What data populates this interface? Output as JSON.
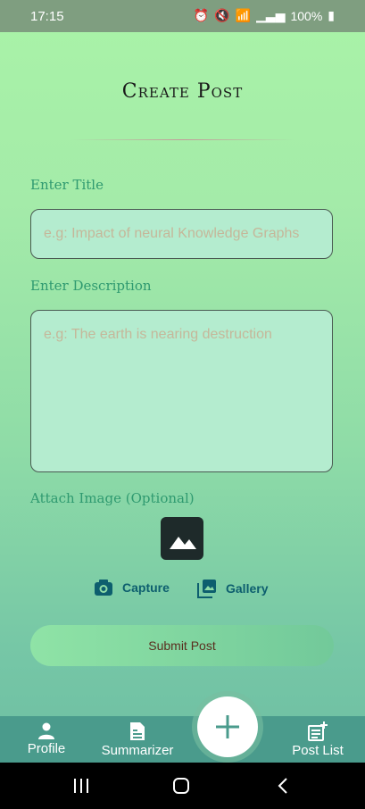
{
  "status": {
    "time": "17:15",
    "battery": "100%"
  },
  "page": {
    "title": "Create Post"
  },
  "form": {
    "title_label": "Enter Title",
    "title_placeholder": "e.g: Impact of neural Knowledge Graphs",
    "description_label": "Enter Description",
    "description_placeholder": "e.g: The earth is nearing destruction",
    "image_label": "Attach Image (Optional)",
    "capture_label": "Capture",
    "gallery_label": "Gallery",
    "submit_label": "Submit Post"
  },
  "nav": {
    "items": [
      {
        "label": "Profile",
        "icon": "person-icon"
      },
      {
        "label": "Summarizer",
        "icon": "document-icon"
      },
      {
        "label": "Post List",
        "icon": "post-list-icon"
      }
    ],
    "fab_icon": "plus-icon"
  },
  "system": {
    "buttons": [
      "recent-apps-icon",
      "home-icon",
      "back-icon"
    ]
  },
  "colors": {
    "accent": "#2f9a70",
    "nav": "#4a9b8c",
    "fab": "#ffffff"
  }
}
